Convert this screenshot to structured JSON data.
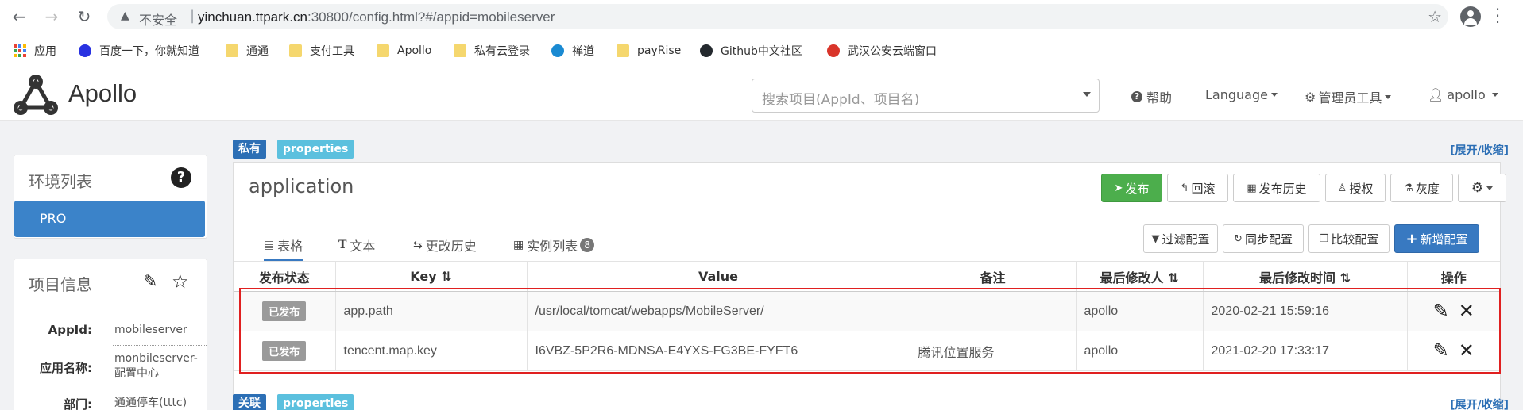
{
  "browser": {
    "insecure_label": "不安全",
    "url_host": "yinchuan.ttpark.cn",
    "url_rest": ":30800/config.html?#/appid=mobileserver",
    "bookmarks": [
      "应用",
      "百度一下，你就知道",
      "通通",
      "支付工具",
      "Apollo",
      "私有云登录",
      "禅道",
      "payRise",
      "Github中文社区",
      "武汉公安云端窗口"
    ]
  },
  "header": {
    "logo_text": "Apollo",
    "search_placeholder": "搜索项目(AppId、项目名)",
    "help": "帮助",
    "language": "Language",
    "admin_tools": "管理员工具",
    "user": "apollo"
  },
  "sidebar": {
    "env_title": "环境列表",
    "env_items": [
      "PRO"
    ],
    "project_title": "项目信息",
    "info": [
      {
        "label": "AppId:",
        "value": "mobileserver"
      },
      {
        "label": "应用名称:",
        "value": "monbileserver-配置中心"
      },
      {
        "label": "部门:",
        "value": "通通停车(tttc)"
      }
    ]
  },
  "namespace": {
    "scope_tag": "私有",
    "format_tag": "properties",
    "expand_label": "[展开/收缩]",
    "name": "application",
    "actions": {
      "publish": "发布",
      "rollback": "回滚",
      "history": "发布历史",
      "authorize": "授权",
      "gray": "灰度"
    },
    "tabs": [
      {
        "label": "表格",
        "icon": "table-icon"
      },
      {
        "label": "文本",
        "icon": "text-icon"
      },
      {
        "label": "更改历史",
        "icon": "history-icon"
      },
      {
        "label": "实例列表",
        "icon": "list-icon",
        "badge": "8"
      }
    ],
    "table_tools": {
      "filter": "过滤配置",
      "sync": "同步配置",
      "compare": "比较配置",
      "add": "新增配置"
    },
    "columns": [
      "发布状态",
      "Key",
      "Value",
      "备注",
      "最后修改人",
      "最后修改时间",
      "操作"
    ],
    "rows": [
      {
        "status": "已发布",
        "key": "app.path",
        "value": "/usr/local/tomcat/webapps/MobileServer/",
        "comment": "",
        "modifier": "apollo",
        "time": "2020-02-21 15:59:16"
      },
      {
        "status": "已发布",
        "key": "tencent.map.key",
        "value": "I6VBZ-5P2R6-MDNSA-E4YXS-FG3BE-FYFT6",
        "comment": "腾讯位置服务",
        "modifier": "apollo",
        "time": "2021-02-20 17:33:17"
      }
    ]
  },
  "namespace2": {
    "scope_tag": "关联",
    "format_tag": "properties",
    "expand_label": "[展开/收缩]"
  },
  "colors": {
    "publish_green": "#4cae4c",
    "primary_blue": "#3879c1",
    "env_blue": "#3b83c9",
    "highlight_red": "#e02020"
  }
}
